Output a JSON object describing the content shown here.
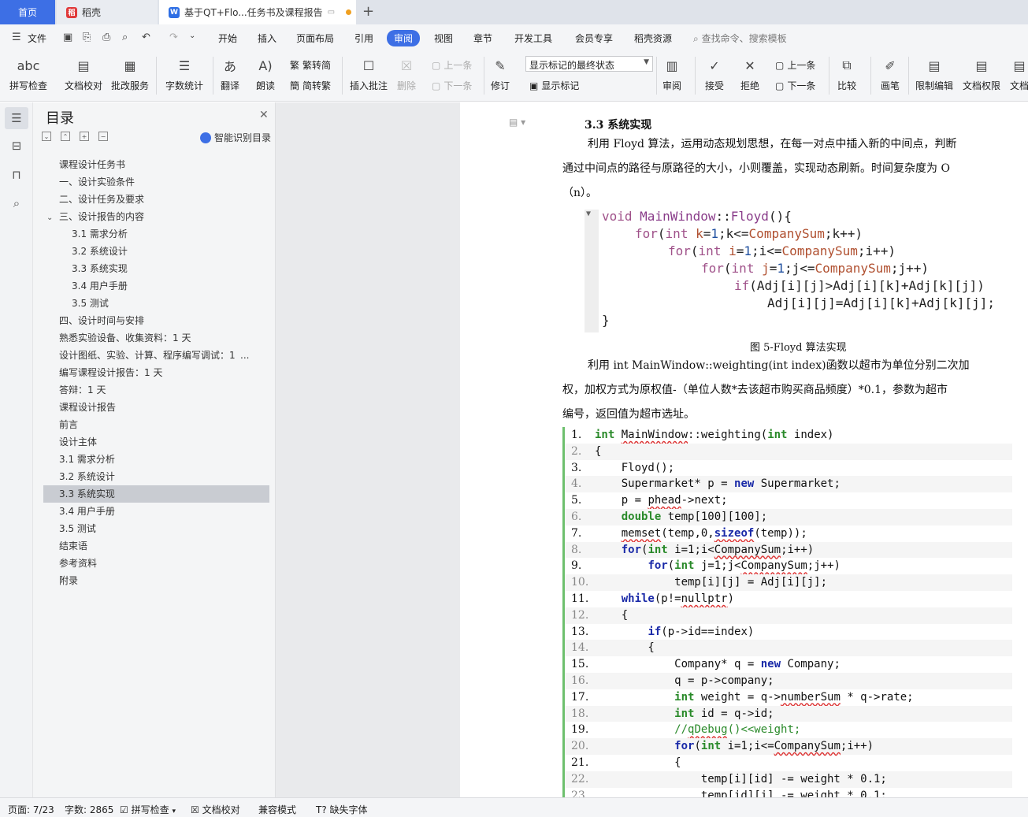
{
  "tabs": {
    "home": "首页",
    "daoke": "稻壳",
    "doc": "基于QT+Flo...任务书及课程报告",
    "add": "+"
  },
  "menu": {
    "file": "文件",
    "items": [
      "开始",
      "插入",
      "页面布局",
      "引用",
      "审阅",
      "视图",
      "章节",
      "开发工具",
      "会员专享",
      "稻壳资源"
    ],
    "search": "查找命令、搜索模板"
  },
  "ribbon": {
    "spell_check": "拼写检查",
    "doc_proof": "文档校对",
    "batch_service": "批改服务",
    "word_count": "字数统计",
    "translate": "翻译",
    "read_aloud": "朗读",
    "trad_to_simp": "繁转简",
    "simp_to_trad": "简转繁",
    "insert_comment": "插入批注",
    "delete": "删除",
    "prev_comment": "上一条",
    "next_comment": "下一条",
    "track_changes": "修订",
    "markup_state": "显示标记的最终状态",
    "show_markup": "显示标记",
    "review_pane": "审阅",
    "accept": "接受",
    "reject": "拒绝",
    "prev_change": "上一条",
    "next_change": "下一条",
    "compare": "比较",
    "pen": "画笔",
    "restrict_edit": "限制编辑",
    "doc_permission": "文档权限",
    "doc_more": "文档"
  },
  "toc": {
    "title": "目录",
    "smart": "智能识别目录",
    "items": [
      "课程设计任务书",
      "一、设计实验条件",
      "二、设计任务及要求",
      "三、设计报告的内容",
      "3.1 需求分析",
      "3.2 系统设计",
      "3.3 系统实现",
      "3.4 用户手册",
      "3.5 测试",
      "四、设计时间与安排",
      "熟悉实验设备、收集资料：1     天",
      "设计图纸、实验、计算、程序编写调试：1",
      "编写课程设计报告：1     天",
      "答辩：1     天",
      "课程设计报告",
      "前言",
      "设计主体",
      "3.1 需求分析",
      "3.2 系统设计",
      "3.3 系统实现",
      "3.4 用户手册",
      "3.5 测试",
      "结束语",
      "参考资料",
      "附录"
    ],
    "ellipsis": "..."
  },
  "doc": {
    "section_title": "3.3 系统实现",
    "para1": [
      "利用 Floyd 算法，运用动态规划思想，在每一对点中插入新的中间点，判断",
      "通过中间点的路径与原路径的大小，小则覆盖，实现动态刷新。时间复杂度为 O",
      "（n）。"
    ],
    "figure_caption": "图 5-Floyd 算法实现",
    "para2": [
      "利用 int MainWindow::weighting(int index)函数以超市为单位分别二次加",
      "权，加权方式为原权值-（单位人数*去该超市购买商品频度）*0.1，参数为超市",
      "编号，返回值为超市选址。"
    ],
    "code_lines": [
      "1.",
      "2.",
      "3.",
      "4.",
      "5.",
      "6.",
      "7.",
      "8.",
      "9.",
      "10.",
      "11.",
      "12.",
      "13.",
      "14.",
      "15.",
      "16.",
      "17.",
      "18.",
      "19.",
      "20.",
      "21.",
      "22.",
      "23."
    ]
  },
  "status": {
    "page": "页面: 7/23",
    "words": "字数: 2865",
    "spell": "拼写检查",
    "proof": "文档校对",
    "compat": "兼容模式",
    "missing_font": "缺失字体"
  }
}
